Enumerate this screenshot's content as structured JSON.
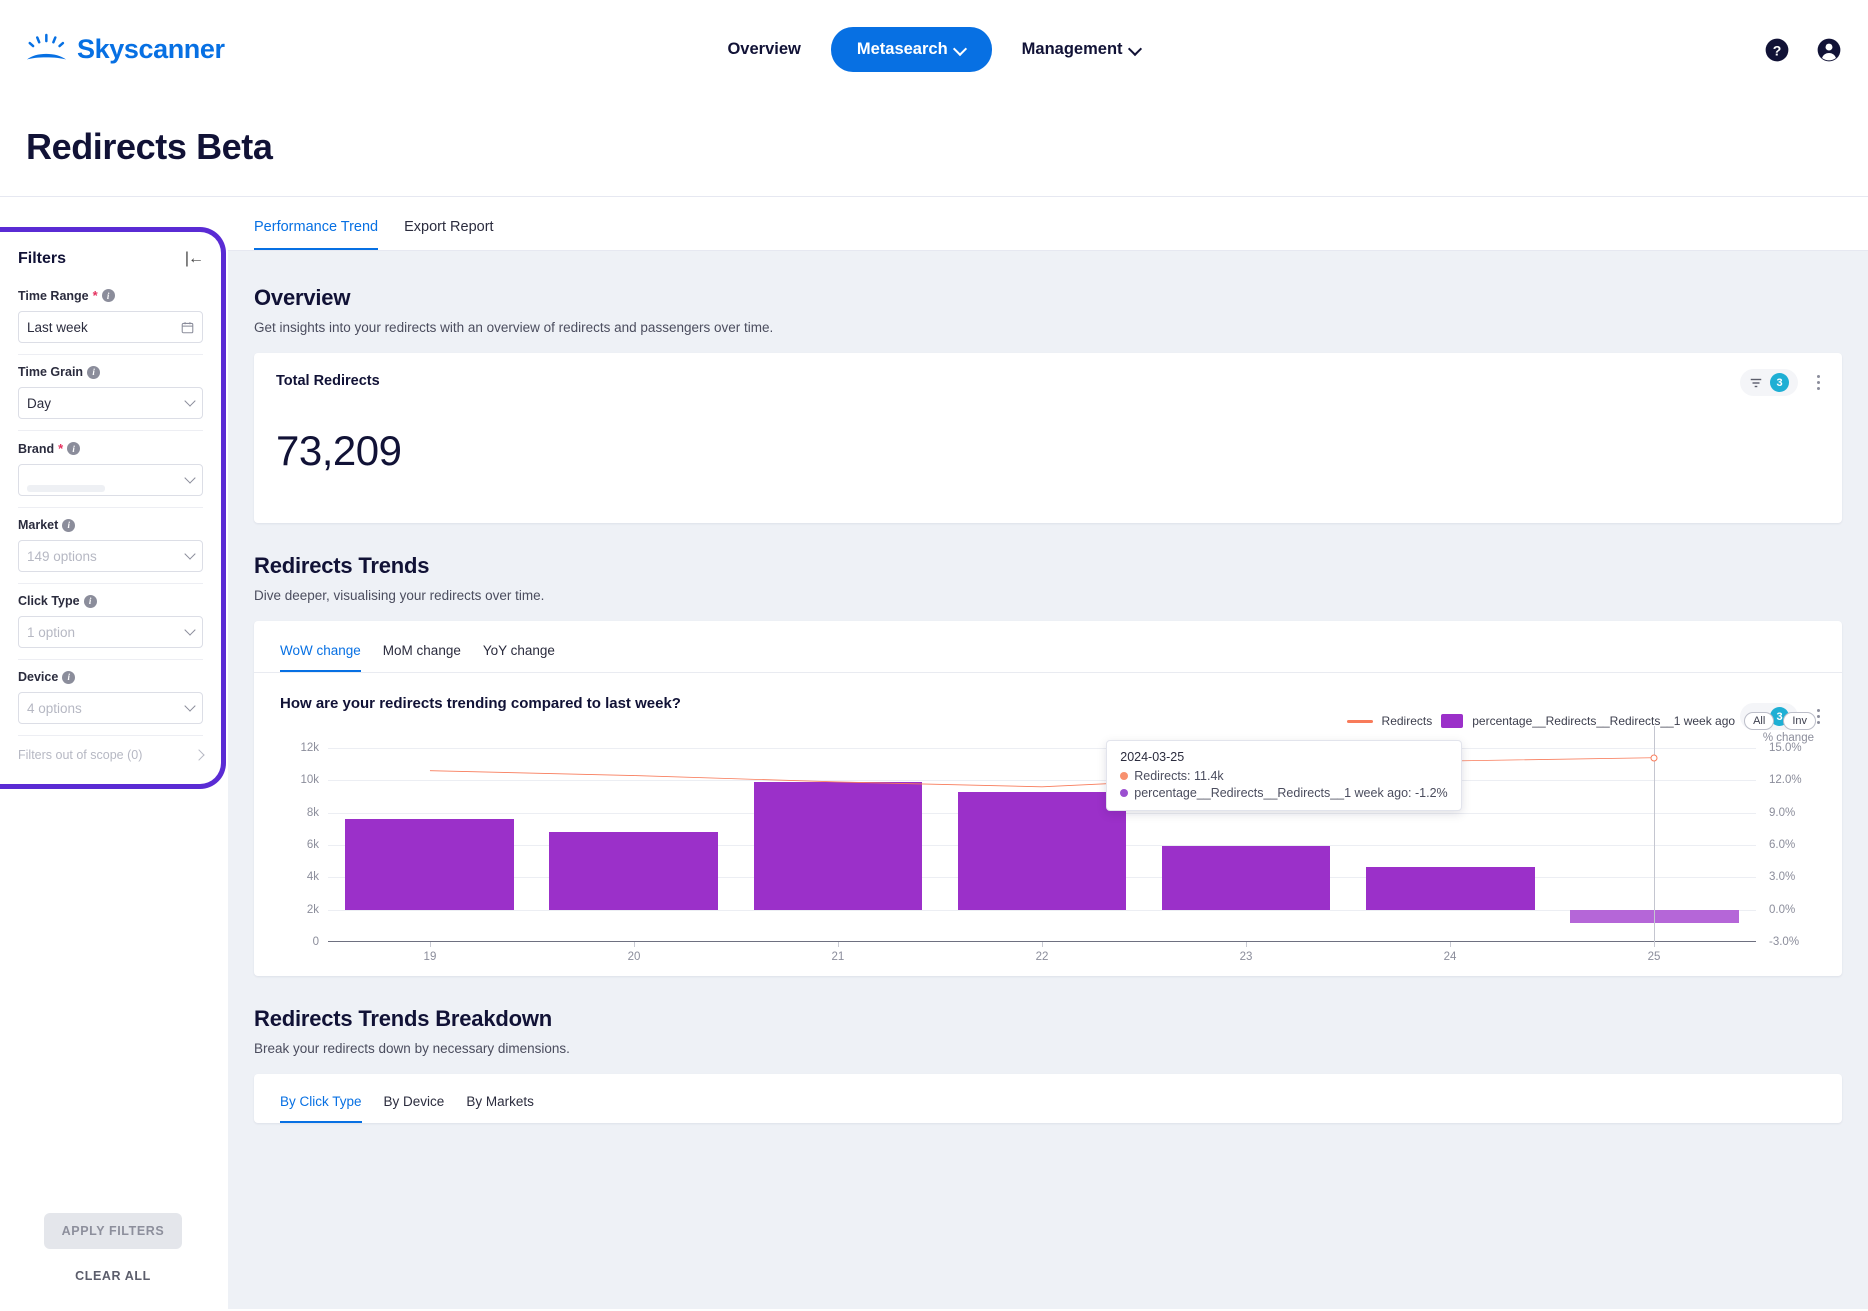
{
  "brand": {
    "name": "Skyscanner",
    "logo_icon": "sun-rays-icon",
    "color": "#0770e3"
  },
  "topnav": {
    "items": [
      {
        "label": "Overview",
        "active": false,
        "has_chevron": false
      },
      {
        "label": "Metasearch",
        "active": true,
        "has_chevron": true
      },
      {
        "label": "Management",
        "active": false,
        "has_chevron": true
      }
    ],
    "right_icons": [
      "help-circle-icon",
      "account-circle-icon"
    ]
  },
  "page": {
    "title": "Redirects Beta"
  },
  "sidebar": {
    "title": "Filters",
    "collapse_icon": "collapse-panel-icon",
    "filters": [
      {
        "label": "Time Range",
        "required": true,
        "info": true,
        "value": "Last week",
        "placeholder": false,
        "tail_icon": "calendar-icon"
      },
      {
        "label": "Time Grain",
        "required": false,
        "info": true,
        "value": "Day",
        "placeholder": false,
        "tail_icon": "chevron-down-icon"
      },
      {
        "label": "Brand",
        "required": true,
        "info": true,
        "value": "",
        "placeholder": true,
        "loading": true,
        "tail_icon": "chevron-down-icon"
      },
      {
        "label": "Market",
        "required": false,
        "info": true,
        "value": "149 options",
        "placeholder": true,
        "tail_icon": "chevron-down-icon"
      },
      {
        "label": "Click Type",
        "required": false,
        "info": true,
        "value": "1 option",
        "placeholder": true,
        "tail_icon": "chevron-down-icon"
      },
      {
        "label": "Device",
        "required": false,
        "info": true,
        "value": "4 options",
        "placeholder": true,
        "tail_icon": "chevron-down-icon"
      }
    ],
    "out_of_scope_label": "Filters out of scope (0)",
    "apply_label": "APPLY FILTERS",
    "clear_label": "CLEAR ALL",
    "highlight_color": "#5a2bd4"
  },
  "main": {
    "tabs": [
      {
        "label": "Performance Trend",
        "active": true
      },
      {
        "label": "Export Report",
        "active": false
      }
    ],
    "overview": {
      "title": "Overview",
      "subtitle": "Get insights into your redirects with an overview of redirects and passengers over time.",
      "kpi": {
        "label": "Total Redirects",
        "value": "73,209"
      },
      "tools": {
        "filter_icon": "filter-icon",
        "filter_badge": "3",
        "menu_icon": "kebab-menu-icon",
        "badge_color": "#1eafd4"
      }
    },
    "trends": {
      "title": "Redirects Trends",
      "subtitle": "Dive deeper, visualising your redirects over time.",
      "tabs": [
        {
          "label": "WoW change",
          "active": true
        },
        {
          "label": "MoM change",
          "active": false
        },
        {
          "label": "YoY change",
          "active": false
        }
      ],
      "question": "How are your redirects trending compared to last week?",
      "tools": {
        "filter_icon": "filter-icon",
        "filter_badge": "3",
        "menu_icon": "kebab-menu-icon"
      },
      "controls": {
        "all_label": "All",
        "inv_label": "Inv"
      },
      "tooltip": {
        "date": "2024-03-25",
        "rows": [
          {
            "color": "#f8916f",
            "text": "Redirects: 11.4k"
          },
          {
            "color": "#9b4fd0",
            "text": "percentage__Redirects__Redirects__1 week ago: -1.2%"
          }
        ]
      }
    },
    "breakdown": {
      "title": "Redirects Trends Breakdown",
      "subtitle": "Break your redirects down by necessary dimensions.",
      "tabs": [
        {
          "label": "By Click Type",
          "active": true
        },
        {
          "label": "By Device",
          "active": false
        },
        {
          "label": "By Markets",
          "active": false
        }
      ]
    }
  },
  "chart_data": {
    "type": "bar",
    "title": "How are your redirects trending compared to last week?",
    "xlabel": "",
    "ylabel": "",
    "y2label": "% change",
    "grid": true,
    "legend_position": "top-right",
    "categories": [
      "19",
      "20",
      "21",
      "22",
      "23",
      "24",
      "25"
    ],
    "ylim": [
      0,
      12000
    ],
    "yticks": [
      "0",
      "2k",
      "4k",
      "6k",
      "8k",
      "10k",
      "12k"
    ],
    "y2lim": [
      -3.0,
      15.0
    ],
    "y2ticks": [
      "-3.0%",
      "0.0%",
      "3.0%",
      "6.0%",
      "9.0%",
      "12.0%",
      "15.0%"
    ],
    "series": [
      {
        "name": "percentage__Redirects__Redirects__1 week ago",
        "type": "bar",
        "axis": "right",
        "color": "#9b30c9",
        "unit": "%",
        "values": [
          8.4,
          7.2,
          11.8,
          10.9,
          5.9,
          4.0,
          -1.2
        ]
      },
      {
        "name": "Redirects",
        "type": "line",
        "axis": "left",
        "color": "#f87b5a",
        "values": [
          10600,
          10300,
          9900,
          9600,
          10200,
          11200,
          11400
        ],
        "value_labels": [
          "10.6k",
          "10.3k",
          "9.9k",
          "9.6k",
          "10.2k",
          "11.2k",
          "11.4k"
        ]
      }
    ],
    "annotations": [
      {
        "type": "tooltip",
        "x": "25",
        "date": "2024-03-25",
        "lines": [
          "Redirects: 11.4k",
          "percentage__Redirects__Redirects__1 week ago: -1.2%"
        ]
      }
    ]
  }
}
